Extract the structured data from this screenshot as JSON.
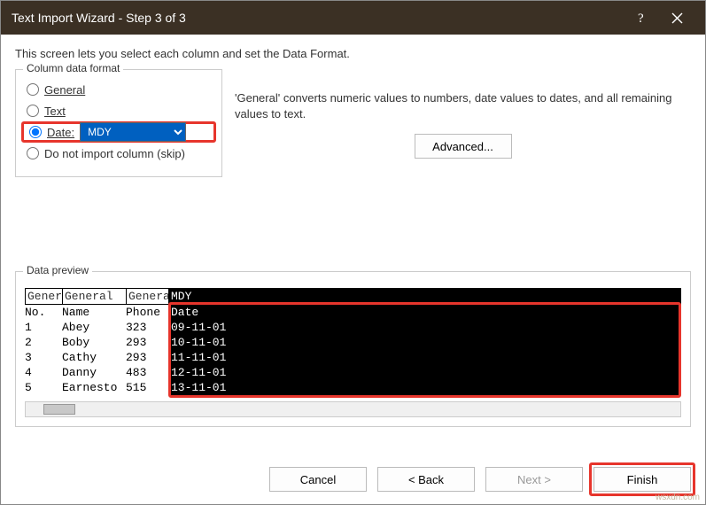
{
  "titlebar": {
    "title": "Text Import Wizard - Step 3 of 3"
  },
  "instruction": "This screen lets you select each column and set the Data Format.",
  "format_group": {
    "legend": "Column data format",
    "general": "General",
    "text": "Text",
    "date": "Date:",
    "date_value": "MDY",
    "skip": "Do not import column (skip)"
  },
  "side": {
    "desc": "'General' converts numeric values to numbers, date values to dates, and all remaining values to text.",
    "advanced": "Advanced..."
  },
  "preview": {
    "legend": "Data preview",
    "headers": [
      "Gener",
      "General",
      "Genera",
      "MDY"
    ],
    "rows": [
      [
        "No.",
        "Name",
        "Phone",
        "Date"
      ],
      [
        "1",
        "Abey",
        "323",
        "09-11-01"
      ],
      [
        "2",
        "Boby",
        "293",
        "10-11-01"
      ],
      [
        "3",
        "Cathy",
        "293",
        "11-11-01"
      ],
      [
        "4",
        "Danny",
        "483",
        "12-11-01"
      ],
      [
        "5",
        "Earnesto",
        "515",
        "13-11-01"
      ]
    ]
  },
  "buttons": {
    "cancel": "Cancel",
    "back": "<  Back",
    "next": "Next  >",
    "finish": "Finish"
  },
  "watermark": "wsxdn.com"
}
